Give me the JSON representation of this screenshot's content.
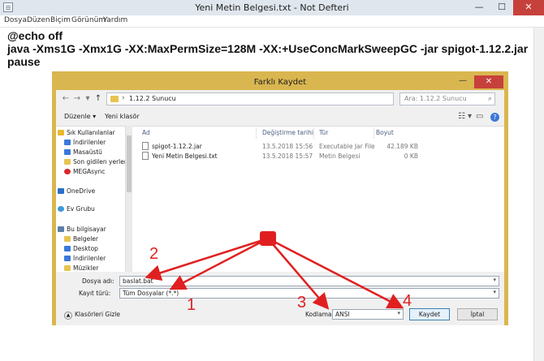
{
  "notepad": {
    "title": "Yeni Metin Belgesi.txt - Not Defteri",
    "menu": [
      "Dosya",
      "Düzen",
      "Biçim",
      "Görünüm",
      "Yardım"
    ],
    "content": "@echo off\njava -Xms1G -Xmx1G -XX:MaxPermSize=128M -XX:+UseConcMarkSweepGC -jar spigot-1.12.2.jar\npause",
    "controls": {
      "minimize": "—",
      "maximize": "☐",
      "close": "✕"
    }
  },
  "dialog": {
    "title": "Farklı Kaydet",
    "close": "✕",
    "minimize": "—",
    "address": {
      "separator": "›",
      "path": "1.12.2 Sunucu"
    },
    "search": {
      "placeholder": "Ara: 1.12.2 Sunucu"
    },
    "toolbar": {
      "organize": "Düzenle ▾",
      "new_folder": "Yeni klasör",
      "help": "?"
    },
    "nav_items": [
      {
        "label": "Sık Kullanılanlar",
        "icon": "star-icon",
        "color": "#e8b82e"
      },
      {
        "label": "İndirilenler",
        "icon": "downloads-icon",
        "color": "#3b78d8"
      },
      {
        "label": "Masaüstü",
        "icon": "desktop-icon",
        "color": "#3b78d8"
      },
      {
        "label": "Son gidilen yerler",
        "icon": "recent-places-icon",
        "color": "#e8c350"
      },
      {
        "label": "MEGAsync",
        "icon": "megasync-icon",
        "color": "#d9272e"
      },
      {
        "label": "OneDrive",
        "icon": "onedrive-icon",
        "color": "#2a6fc9"
      },
      {
        "label": "Ev Grubu",
        "icon": "homegroup-icon",
        "color": "#3a9ad9"
      },
      {
        "label": "Bu bilgisayar",
        "icon": "computer-icon",
        "color": "#5a7fa8"
      },
      {
        "label": "Belgeler",
        "icon": "documents-icon",
        "color": "#e8c350"
      },
      {
        "label": "Desktop",
        "icon": "desktop-folder-icon",
        "color": "#3b78d8"
      },
      {
        "label": "İndirilenler",
        "icon": "downloads-folder-icon",
        "color": "#3b78d8"
      },
      {
        "label": "Müzikler",
        "icon": "music-icon",
        "color": "#e8c350"
      }
    ],
    "columns": [
      "Ad",
      "Değiştirme tarihi",
      "Tür",
      "Boyut"
    ],
    "files": [
      {
        "name": "spigot-1.12.2.jar",
        "modified": "13.5.2018 15:56",
        "type": "Executable Jar File",
        "size": "42.189 KB"
      },
      {
        "name": "Yeni Metin Belgesi.txt",
        "modified": "13.5.2018 15:57",
        "type": "Metin Belgesi",
        "size": "0 KB"
      }
    ],
    "filename_label": "Dosya adı:",
    "filename_value": "baslat.bat",
    "filetype_label": "Kayıt türü:",
    "filetype_value": "Tüm Dosyalar  (*.*)",
    "encoding_label": "Kodlama:",
    "encoding_value": "ANSI",
    "save_button": "Kaydet",
    "cancel_button": "İptal",
    "hide_folders": "Klasörleri Gizle"
  },
  "annotations": {
    "labels": [
      "1",
      "2",
      "3",
      "4"
    ],
    "color": "#e02020"
  }
}
